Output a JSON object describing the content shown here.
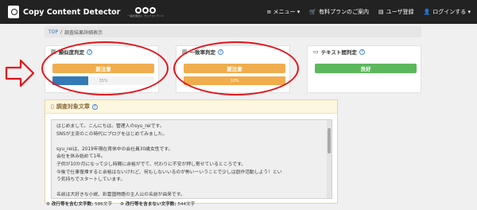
{
  "header": {
    "brand": "Copy Content Detector",
    "logo_sub": "一般社団法人 ウェブコンテンツ",
    "menu_label": "≡ メニュー ▾",
    "plan_label": "有料プランのご案内",
    "register_label": "ユーザ登録",
    "login_label": "ログインする ▾"
  },
  "breadcrumb": {
    "home": "TOP",
    "sep": "/",
    "current": "調査結果詳細表示"
  },
  "cards": [
    {
      "title": "類似度判定",
      "badge": "要注意",
      "badge_color": "#f0ad4e",
      "progress_label": "35%",
      "progress": 0.35,
      "bar_color": "#337ab7"
    },
    {
      "title": "一致率判定",
      "badge": "要注意",
      "badge_color": "#f0ad4e",
      "progress_label": "10%",
      "progress": 1.0,
      "bar_color": "#f0ad4e"
    },
    {
      "title": "テキスト間判定",
      "badge": "良好",
      "badge_color": "#5cb85c"
    }
  ],
  "panel": {
    "title": "調査対象文章",
    "lines": [
      "はじめまして。こんにちは。管理人のsyu_reiです。",
      "SNSが主流のこの時代にブログをはじめてみました。",
      "",
      "syu_reiは、2019年現在育休中の会社員30歳女性です。",
      "会社を休み始めて1年。",
      "子供が10か月になって少し時間に余裕がでて、代わりに不安が押し寄せているところです。",
      "今後で仕事復帰すると余裕はないけれど、何もしないいるのが怖いーいうことで少しは創作活動しよう！とい",
      "う気持ちでスタートしています。",
      "",
      "名前は大好きな小説、彩雲国物語の主人公の名前が由来です。"
    ]
  },
  "counts": {
    "with_newline_label": "改行等を含む文字数:",
    "with_newline_value": "586文字",
    "without_newline_label": "改行等を含まない文字数:",
    "without_newline_value": "544文字"
  },
  "colors": {
    "annotation": "#e3141a",
    "topbar": "#222222",
    "panel_border": "#e8d59c"
  }
}
